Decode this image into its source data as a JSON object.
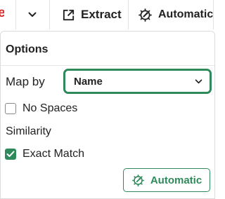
{
  "toolbar": {
    "cut_label": "e",
    "extract_label": "Extract",
    "automatic_label": "Automatic"
  },
  "options": {
    "title": "Options",
    "map_by_label": "Map by",
    "map_by_value": "Name",
    "no_spaces_label": "No Spaces",
    "no_spaces_checked": false,
    "similarity_title": "Similarity",
    "exact_match_label": "Exact Match",
    "exact_match_checked": true,
    "automatic_button_label": "Automatic"
  },
  "colors": {
    "accent": "#2f8a5b",
    "toolbar_red": "#d9302c"
  },
  "icons": {
    "dropdown": "chevron-down-icon",
    "extract": "external-link-icon",
    "automatic": "gear-wand-icon",
    "select": "chevron-down-icon",
    "check": "checkmark-icon"
  }
}
